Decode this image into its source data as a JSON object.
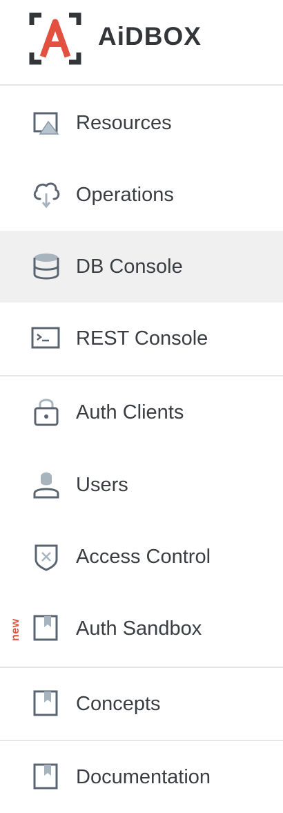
{
  "brand": {
    "logo_letter": "A",
    "name": "AiDBOX",
    "accent_color": "#e2503f",
    "dark_color": "#333538"
  },
  "nav": {
    "active": "DB Console",
    "items": [
      {
        "label": "Resources",
        "icon": "resources-icon"
      },
      {
        "label": "Operations",
        "icon": "cloud-icon"
      },
      {
        "label": "DB Console",
        "icon": "database-icon"
      },
      {
        "label": "REST Console",
        "icon": "terminal-icon"
      },
      {
        "label": "Auth Clients",
        "icon": "lock-icon"
      },
      {
        "label": "Users",
        "icon": "user-icon"
      },
      {
        "label": "Access Control",
        "icon": "shield-icon"
      },
      {
        "label": "Auth Sandbox",
        "icon": "bookmark-icon",
        "badge": "new"
      },
      {
        "label": "Concepts",
        "icon": "bookmark-icon"
      },
      {
        "label": "Documentation",
        "icon": "bookmark-icon"
      }
    ]
  }
}
